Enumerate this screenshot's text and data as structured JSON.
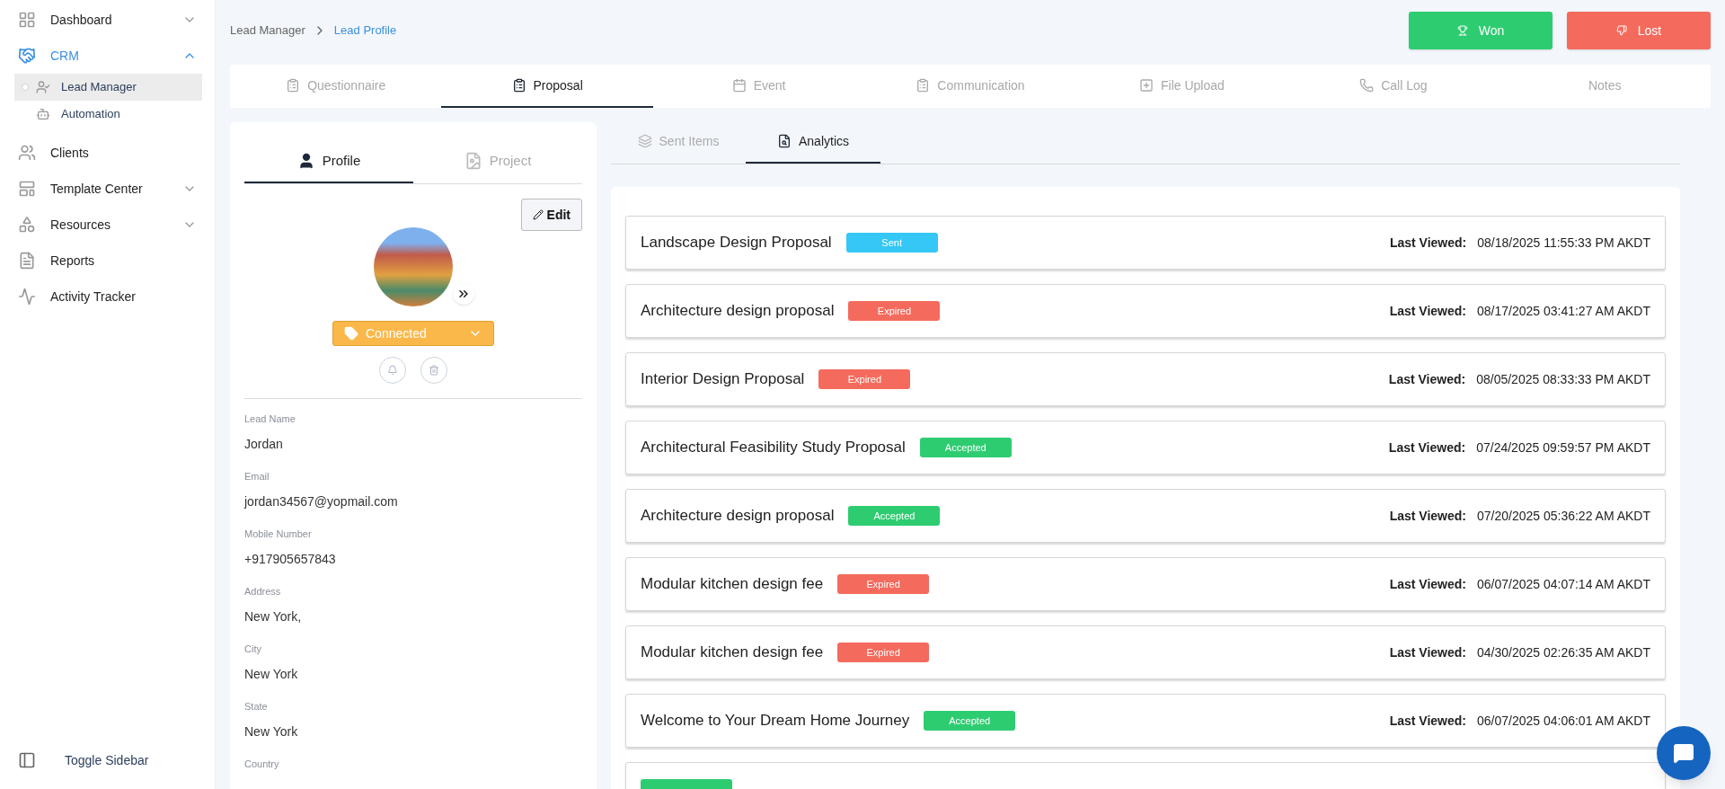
{
  "sidebar": {
    "items": [
      {
        "label": "Dashboard",
        "expanded": false,
        "selected": false
      },
      {
        "label": "CRM",
        "expanded": true,
        "selected": true,
        "children": [
          {
            "label": "Lead Manager",
            "selected": true
          },
          {
            "label": "Automation",
            "selected": false
          }
        ]
      },
      {
        "label": "Clients",
        "selected": false
      },
      {
        "label": "Template Center",
        "expanded": false,
        "selected": false
      },
      {
        "label": "Resources",
        "expanded": false,
        "selected": false
      },
      {
        "label": "Reports",
        "selected": false
      },
      {
        "label": "Activity Tracker",
        "selected": false
      }
    ],
    "toggle": "Toggle Sidebar"
  },
  "breadcrumb": [
    {
      "label": "Lead Manager",
      "current": false
    },
    {
      "label": "Lead Profile",
      "current": true
    }
  ],
  "actions": [
    {
      "label": "Won",
      "kind": "won"
    },
    {
      "label": "Lost",
      "kind": "lost"
    }
  ],
  "tabs": [
    {
      "label": "Questionnaire",
      "selected": false
    },
    {
      "label": "Proposal",
      "selected": true
    },
    {
      "label": "Event",
      "selected": false
    },
    {
      "label": "Communication",
      "selected": false
    },
    {
      "label": "File Upload",
      "selected": false
    },
    {
      "label": "Call Log",
      "selected": false
    },
    {
      "label": "Notes",
      "selected": false
    }
  ],
  "profile_panel": {
    "tabs": [
      {
        "label": "Profile",
        "selected": true
      },
      {
        "label": "Project",
        "selected": false
      }
    ],
    "edit_button": "Edit",
    "status": "Connected",
    "fields": [
      {
        "label": "Lead Name",
        "value": "Jordan"
      },
      {
        "label": "Email",
        "value": "jordan34567@yopmail.com"
      },
      {
        "label": "Mobile Number",
        "value": "+917905657843"
      },
      {
        "label": "Address",
        "value": "New York,"
      },
      {
        "label": "City",
        "value": "New York"
      },
      {
        "label": "State",
        "value": "New York"
      },
      {
        "label": "Country"
      }
    ]
  },
  "sub_tabs": [
    {
      "label": "Sent Items",
      "selected": false
    },
    {
      "label": "Analytics",
      "selected": true
    }
  ],
  "proposals": [
    {
      "title": "Landscape Design Proposal",
      "status": "Sent",
      "kind": "sent",
      "viewed_label": "Last Viewed:",
      "viewed": "08/18/2025 11:55:33 PM AKDT"
    },
    {
      "title": "Architecture design proposal",
      "status": "Expired",
      "kind": "expired",
      "viewed_label": "Last Viewed:",
      "viewed": "08/17/2025 03:41:27 AM AKDT"
    },
    {
      "title": "Interior Design Proposal",
      "status": "Expired",
      "kind": "expired",
      "viewed_label": "Last Viewed:",
      "viewed": "08/05/2025 08:33:33 PM AKDT"
    },
    {
      "title": "Architectural Feasibility Study Proposal",
      "status": "Accepted",
      "kind": "accepted",
      "viewed_label": "Last Viewed:",
      "viewed": "07/24/2025 09:59:57 PM AKDT"
    },
    {
      "title": "Architecture design proposal",
      "status": "Accepted",
      "kind": "accepted",
      "viewed_label": "Last Viewed:",
      "viewed": "07/20/2025 05:36:22 AM AKDT"
    },
    {
      "title": "Modular kitchen design fee",
      "status": "Expired",
      "kind": "expired",
      "viewed_label": "Last Viewed:",
      "viewed": "06/07/2025 04:07:14 AM AKDT"
    },
    {
      "title": "Modular kitchen design fee",
      "status": "Expired",
      "kind": "expired",
      "viewed_label": "Last Viewed:",
      "viewed": "04/30/2025 02:26:35 AM AKDT"
    },
    {
      "title": "Welcome to Your Dream Home Journey",
      "status": "Accepted",
      "kind": "accepted",
      "viewed_label": "Last Viewed:",
      "viewed": "06/07/2025 04:06:01 AM AKDT"
    },
    {
      "kind": "accepted"
    }
  ]
}
